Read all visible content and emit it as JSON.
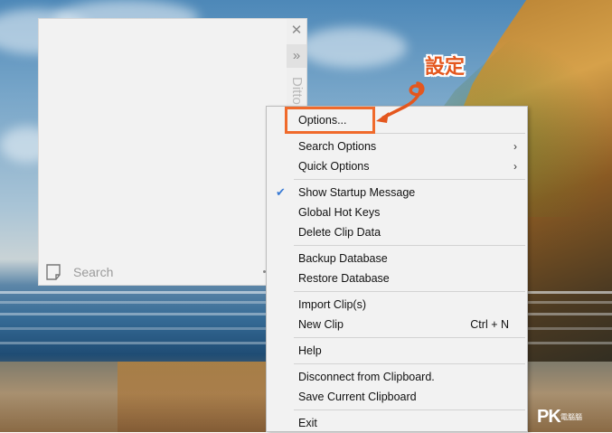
{
  "annotation": {
    "label": "設定",
    "color": "#e4571e"
  },
  "ditto": {
    "title": "Ditto",
    "close_glyph": "✕",
    "more_glyph": "»",
    "search_placeholder": "Search"
  },
  "menu": {
    "items": [
      {
        "label": "Options...",
        "highlighted": true
      },
      {
        "label": "Search Options",
        "submenu": true
      },
      {
        "label": "Quick Options",
        "submenu": true
      },
      {
        "label": "Show Startup Message",
        "checked": true
      },
      {
        "label": "Global Hot Keys"
      },
      {
        "label": "Delete Clip Data"
      },
      {
        "label": "Backup Database"
      },
      {
        "label": "Restore Database"
      },
      {
        "label": "Import Clip(s)"
      },
      {
        "label": "New Clip",
        "shortcut": "Ctrl + N"
      },
      {
        "label": "Help"
      },
      {
        "label": "Disconnect from Clipboard."
      },
      {
        "label": "Save Current Clipboard"
      },
      {
        "label": "Exit"
      }
    ]
  },
  "watermark": {
    "brand": "PK",
    "sub": "電腦腦"
  },
  "colors": {
    "highlight_border": "#f06a2b",
    "check": "#3a7bd5",
    "menu_bg": "#f2f2f2"
  }
}
